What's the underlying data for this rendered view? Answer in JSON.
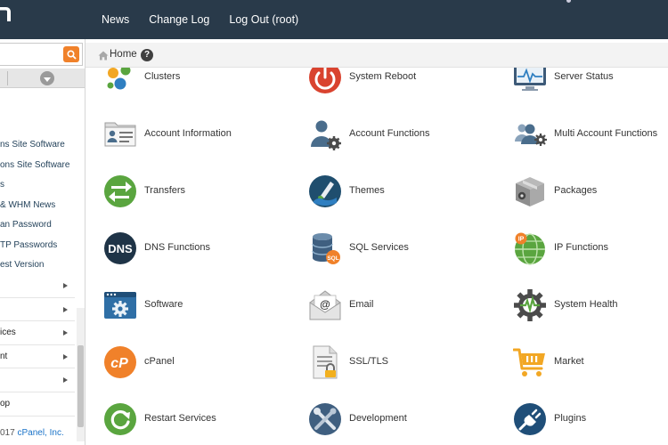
{
  "topnav": {
    "items": [
      "News",
      "Change Log",
      "Log Out (root)"
    ]
  },
  "sidebar": {
    "search_value": "",
    "links": [
      "ns Site Software",
      "ons Site Software",
      "s",
      "& WHM News",
      "an Password",
      "TP Passwords",
      "est Version"
    ],
    "groups": [
      "",
      "",
      "ices",
      "nt",
      "",
      "op"
    ],
    "copyright_prefix": "017 ",
    "copyright_link": "cPanel, Inc."
  },
  "breadcrumb": {
    "home": "Home",
    "help": "?"
  },
  "tiles": [
    {
      "label": "Clusters",
      "icon": "clusters-icon"
    },
    {
      "label": "System Reboot",
      "icon": "power-icon"
    },
    {
      "label": "Server Status",
      "icon": "monitor-icon"
    },
    {
      "label": "Account Information",
      "icon": "id-card-icon"
    },
    {
      "label": "Account Functions",
      "icon": "user-gear-icon"
    },
    {
      "label": "Multi Account Functions",
      "icon": "users-gear-icon"
    },
    {
      "label": "Transfers",
      "icon": "transfer-arrows-icon"
    },
    {
      "label": "Themes",
      "icon": "paint-brush-icon"
    },
    {
      "label": "Packages",
      "icon": "package-box-icon"
    },
    {
      "label": "DNS Functions",
      "icon": "dns-icon"
    },
    {
      "label": "SQL Services",
      "icon": "database-icon"
    },
    {
      "label": "IP Functions",
      "icon": "globe-ip-icon"
    },
    {
      "label": "Software",
      "icon": "software-window-icon"
    },
    {
      "label": "Email",
      "icon": "envelope-icon"
    },
    {
      "label": "System Health",
      "icon": "gear-pulse-icon"
    },
    {
      "label": "cPanel",
      "icon": "cpanel-logo-icon"
    },
    {
      "label": "SSL/TLS",
      "icon": "lock-document-icon"
    },
    {
      "label": "Market",
      "icon": "shopping-cart-icon"
    },
    {
      "label": "Restart Services",
      "icon": "restart-icon"
    },
    {
      "label": "Development",
      "icon": "tools-icon"
    },
    {
      "label": "Plugins",
      "icon": "plug-icon"
    }
  ]
}
